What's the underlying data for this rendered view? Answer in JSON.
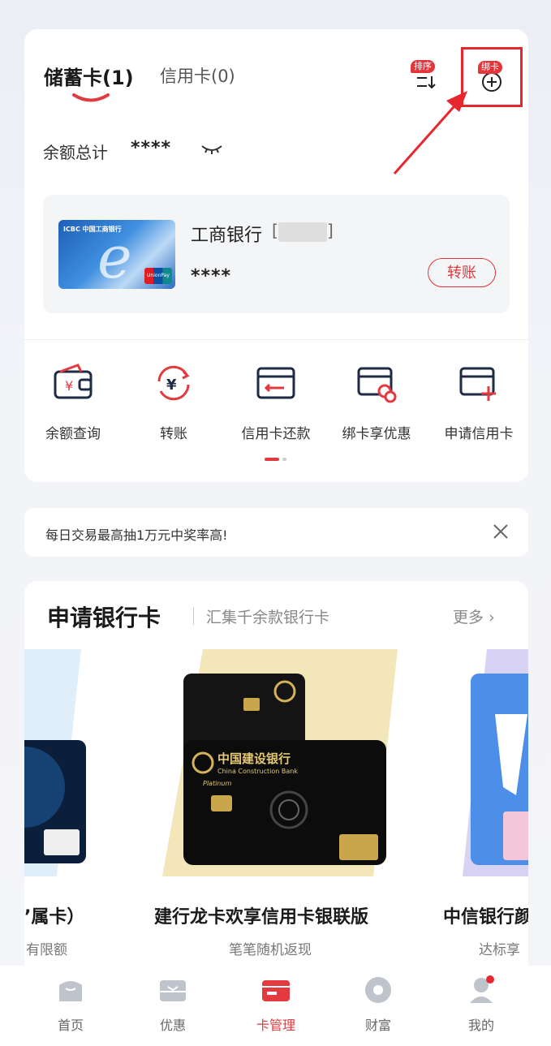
{
  "tabs": {
    "debit_label": "储蓄卡(1)",
    "credit_label": "信用卡(0)"
  },
  "header_actions": {
    "sort_badge": "排序",
    "bind_badge": "绑卡"
  },
  "balance": {
    "label": "余额总计",
    "value": "****"
  },
  "bank_card": {
    "bank_name": "工商银行",
    "bracket_left": "[",
    "bracket_right": "]",
    "balance_masked": "****",
    "transfer_label": "转账",
    "card_brand_text": "ICBC 中国工商银行",
    "card_network": "UnionPay 银联"
  },
  "quick_actions": [
    {
      "label": "余额查询",
      "icon": "wallet-yuan-icon"
    },
    {
      "label": "转账",
      "icon": "transfer-yuan-icon"
    },
    {
      "label": "信用卡还款",
      "icon": "card-repay-icon"
    },
    {
      "label": "绑卡享优惠",
      "icon": "card-link-icon"
    },
    {
      "label": "申请信用卡",
      "icon": "card-add-icon"
    }
  ],
  "promo": {
    "text": "每日交易最高抽1万元中奖率高!"
  },
  "apply_section": {
    "title": "申请银行卡",
    "subtitle": "汇集千余款银行卡",
    "more_label": "更多",
    "cards": [
      {
        "caption": "ʼ属卡）",
        "sub": "有限额"
      },
      {
        "caption": "建行龙卡欢享信用卡银联版",
        "sub": "笔笔随机返现",
        "bank_text": "中国建设银行",
        "bank_en": "China Construction Bank",
        "tier": "Platinum"
      },
      {
        "caption": "中信银行颜",
        "sub": "达标享"
      }
    ]
  },
  "bottom_nav": [
    {
      "label": "首页",
      "icon": "home-icon"
    },
    {
      "label": "优惠",
      "icon": "coupon-icon"
    },
    {
      "label": "卡管理",
      "icon": "card-manage-icon",
      "active": true
    },
    {
      "label": "财富",
      "icon": "wealth-icon"
    },
    {
      "label": "我的",
      "icon": "profile-icon"
    }
  ],
  "colors": {
    "accent": "#e23a3f",
    "highlight_box": "#e8262d"
  }
}
